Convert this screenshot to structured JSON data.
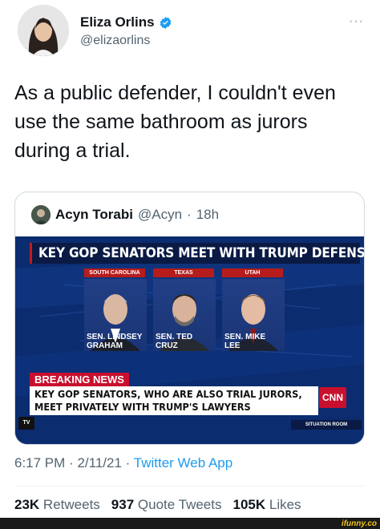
{
  "author": {
    "name": "Eliza Orlins",
    "handle": "@elizaorlins",
    "verified_icon": "verified-badge-icon",
    "more_label": "···"
  },
  "tweet": {
    "text": "As a public defender, I couldn't even use the same bathroom as jurors during a trial."
  },
  "quoted": {
    "name": "Acyn Torabi",
    "handle": "@Acyn",
    "separator": "·",
    "age": "18h",
    "media": {
      "banner": "KEY GOP SENATORS MEET WITH TRUMP DEFENSE TEAM",
      "states": [
        "SOUTH CAROLINA",
        "TEXAS",
        "UTAH"
      ],
      "nameplates": [
        {
          "line1": "SEN. LINDSEY",
          "line2": "GRAHAM"
        },
        {
          "line1": "SEN. TED",
          "line2": "CRUZ"
        },
        {
          "line1": "SEN. MIKE",
          "line2": "LEE"
        }
      ],
      "breaking_label": "BREAKING NEWS",
      "breaking_text": "KEY GOP SENATORS, WHO ARE ALSO TRIAL JURORS, MEET PRIVATELY WITH TRUMP'S LAWYERS",
      "network_logo": "CNN",
      "program": "SITUATION ROOM",
      "tv_bug": "TV"
    }
  },
  "meta": {
    "time": "6:17 PM",
    "dot": "·",
    "date": "2/11/21",
    "source": "Twitter Web App"
  },
  "stats": {
    "retweets_count": "23K",
    "retweets_label": "Retweets",
    "quotes_count": "937",
    "quotes_label": "Quote Tweets",
    "likes_count": "105K",
    "likes_label": "Likes"
  },
  "watermark": "ifunny.co",
  "colors": {
    "link_blue": "#1d9bf0",
    "secondary_text": "#536471",
    "cnn_red": "#c8102e"
  }
}
